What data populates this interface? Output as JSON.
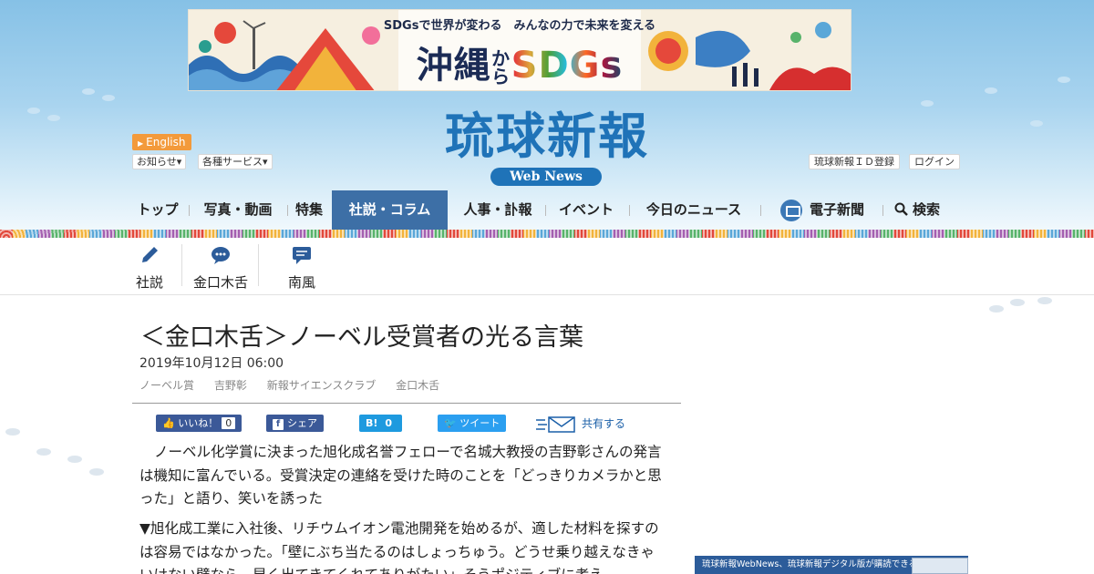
{
  "banner": {
    "tagline": "SDGsで世界が変わる　みんなの力で未来を変える",
    "title_main": "沖縄",
    "title_kara": "から",
    "title_sdgs": "SDGs"
  },
  "logo": {
    "title": "琉球新報",
    "sub": "Web News"
  },
  "topbar": {
    "english": "English",
    "notice": "お知らせ▾",
    "services": "各種サービス▾",
    "register": "琉球新報ＩＤ登録",
    "login": "ログイン"
  },
  "nav": {
    "items": [
      "トップ",
      "写真・動画",
      "特集",
      "社説・コラム",
      "人事・訃報",
      "イベント",
      "今日のニュース",
      "電子新聞",
      "検索"
    ]
  },
  "subnav": {
    "items": [
      "社説",
      "金口木舌",
      "南風"
    ]
  },
  "article": {
    "title": "＜金口木舌＞ノーベル受賞者の光る言葉",
    "date": "2019年10月12日 06:00",
    "tags": [
      "ノーベル賞",
      "吉野彰",
      "新報サイエンスクラブ",
      "金口木舌"
    ],
    "p1": "ノーベル化学賞に決まった旭化成名誉フェローで名城大教授の吉野彰さんの発言は機知に富んでいる。受賞決定の連絡を受けた時のことを「どっきりカメラかと思った」と語り、笑いを誘った",
    "p2": "▼旭化成工業に入社後、リチウムイオン電池開発を始めるが、適した材料を探すのは容易ではなかった。「壁にぶち当たるのはしょっちゅう。どうせ乗り越えなきゃいけない壁なら、早く出てきてくれてありがたい」そうポジティブに考え"
  },
  "share": {
    "like_label": "いいね！",
    "like_count": "0",
    "fb_share": "シェア",
    "hatena_label": "B!",
    "hatena_count": "0",
    "tweet": "ツイート",
    "mail": "共有する"
  },
  "side_ad": {
    "text": "琉球新報WebNews、琉球新報デジタル版が購読できる"
  },
  "colors": {
    "brand": "#1f73b8",
    "nav_active": "#3d6fa6",
    "facebook": "#3b5998",
    "twitter": "#2b9ff0",
    "english_badge": "#f39a3b"
  }
}
